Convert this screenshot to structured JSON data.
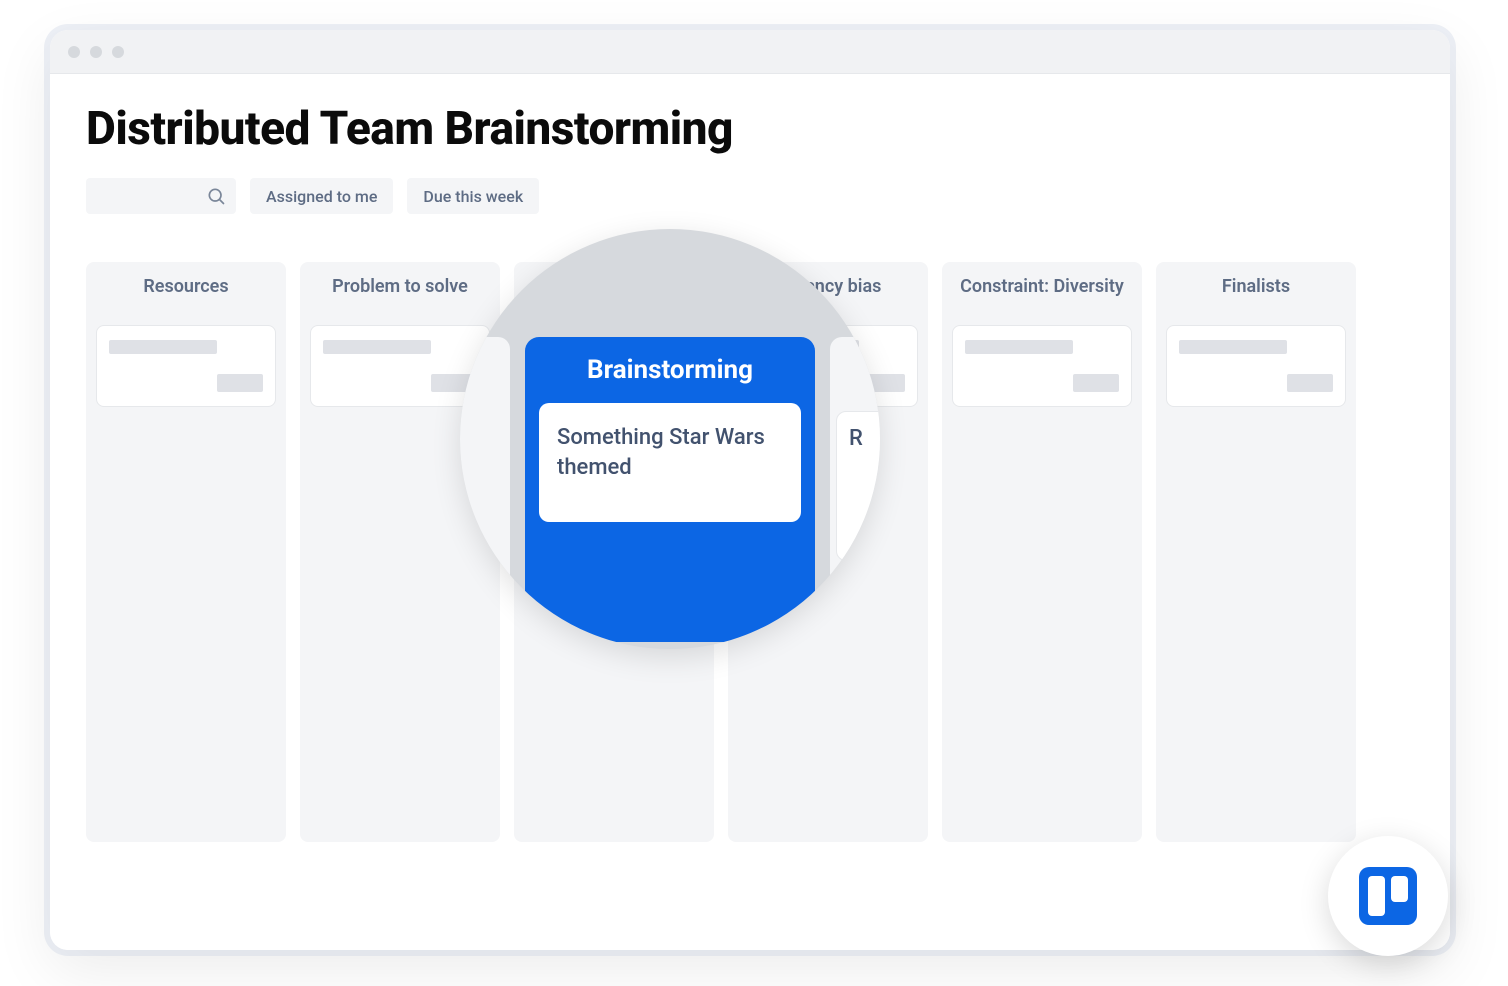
{
  "board": {
    "title": "Distributed Team Brainstorming"
  },
  "filters": {
    "assigned_label": "Assigned to me",
    "due_label": "Due this week"
  },
  "columns": [
    {
      "title": "Resources"
    },
    {
      "title": "Problem to solve"
    },
    {
      "title": "Brainstorming"
    },
    {
      "title": "Recency bias"
    },
    {
      "title": "Constraint: Diversity"
    },
    {
      "title": "Finalists"
    }
  ],
  "magnifier": {
    "column_title": "Brainstorming",
    "card_text": "Something Star Wars themed",
    "peek_text": "R"
  },
  "icons": {
    "search": "search-icon",
    "app": "trello-icon"
  },
  "colors": {
    "accent": "#0c66e4",
    "column_bg": "#f4f5f7",
    "text_muted": "#5e6c84"
  }
}
